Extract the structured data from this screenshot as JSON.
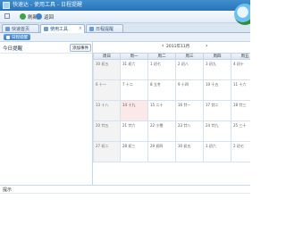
{
  "window": {
    "title": "快速达 - 使用工具 - 日程提醒"
  },
  "toolbar": {
    "refresh_label": "刷新",
    "return_label": "返回"
  },
  "tabs": [
    {
      "label": "快速首页",
      "active": false
    },
    {
      "label": "使用工具",
      "active": true
    },
    {
      "label": "日程提醒",
      "active": false
    }
  ],
  "subtab": {
    "label": "日程提醒"
  },
  "left_panel": {
    "title": "今日提醒",
    "add_button": "添加事件"
  },
  "calendar": {
    "month_label": "2011年11月",
    "weekdays": [
      "周日",
      "周一",
      "周二",
      "周三",
      "周四",
      "周五"
    ],
    "rows": [
      [
        "30 初五",
        "31 初六",
        "1 初七",
        "2 初八",
        "3 初九",
        "4 初十"
      ],
      [
        "6 十一",
        "7 十二",
        "8 立冬",
        "9 十四",
        "10 十五",
        "11 十六"
      ],
      [
        "13 十八",
        "14 十九",
        "15 二十",
        "16 廿一",
        "17 廿二",
        "18 廿三"
      ],
      [
        "20 廿五",
        "21 廿六",
        "22 小雪",
        "23 廿八",
        "24 廿九",
        "25 三十"
      ],
      [
        "27 初二",
        "28 初三",
        "29 初四",
        "30 初五",
        "1 初六",
        "2 初七"
      ]
    ],
    "today": {
      "row": 2,
      "col": 1
    }
  },
  "status_panel": {
    "label": "提示"
  }
}
